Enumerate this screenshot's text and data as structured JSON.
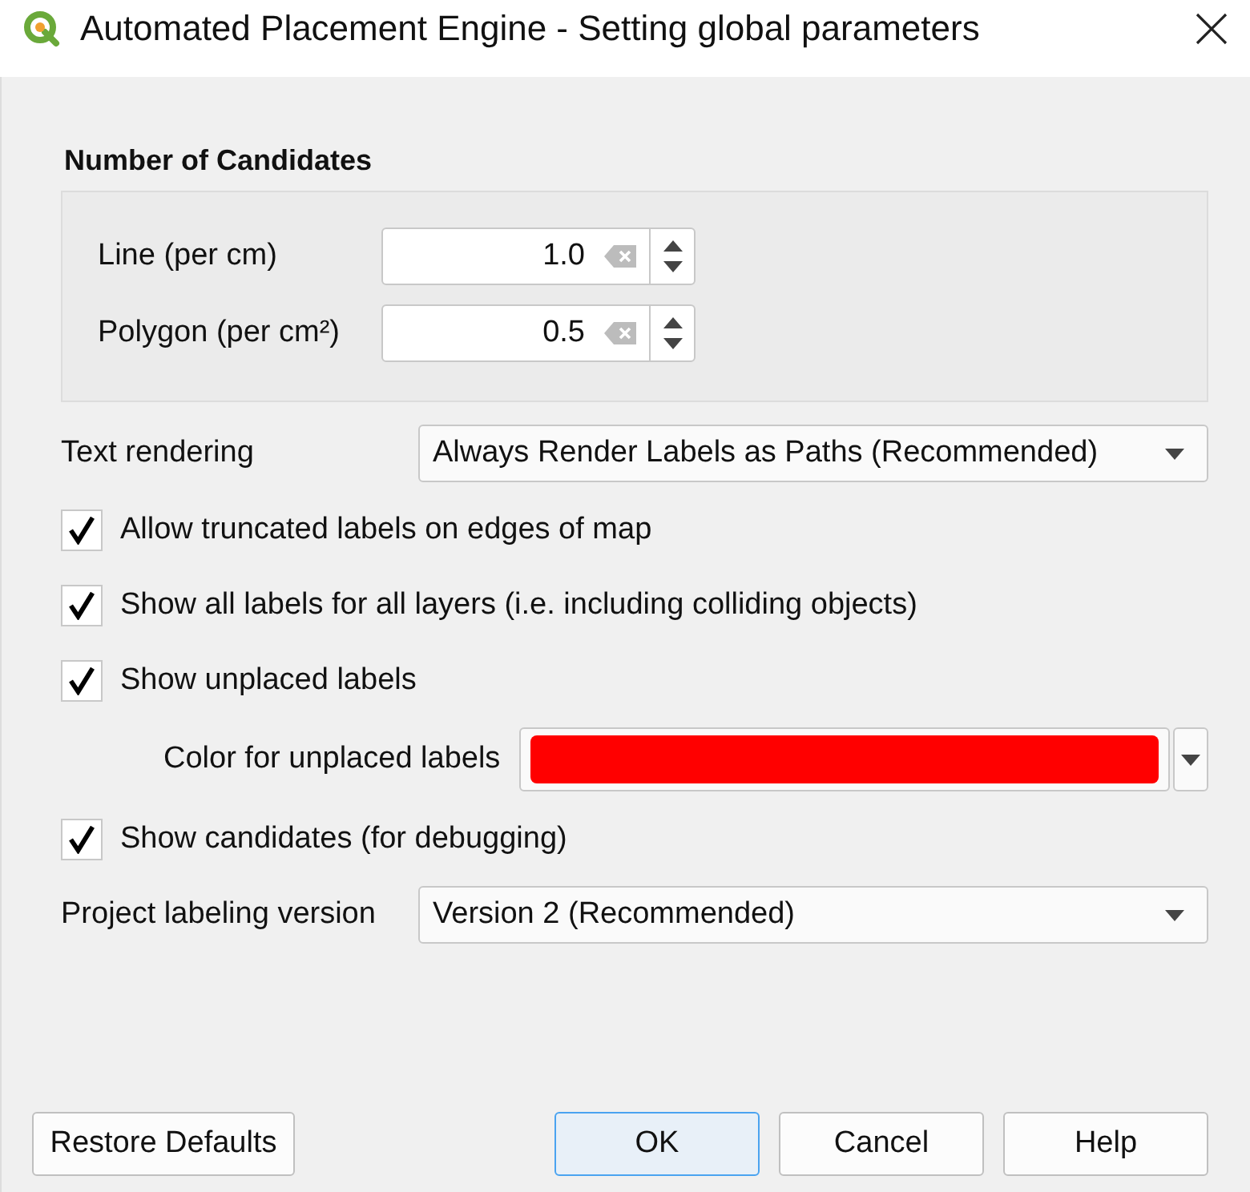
{
  "window": {
    "title": "Automated Placement Engine - Setting global parameters"
  },
  "number_of_candidates": {
    "title": "Number of Candidates",
    "fields": [
      {
        "label": "Line (per cm)",
        "value": "1.0"
      },
      {
        "label": "Polygon (per cm²)",
        "value": "0.5"
      }
    ]
  },
  "text_rendering": {
    "label": "Text rendering",
    "value": "Always Render Labels as Paths (Recommended)"
  },
  "options": [
    {
      "kind": "checkbox",
      "label": "Allow truncated labels on edges of map",
      "checked": true
    },
    {
      "kind": "checkbox",
      "label": "Show all labels for all layers (i.e. including colliding objects)",
      "checked": true
    },
    {
      "kind": "checkbox",
      "label": "Show unplaced labels",
      "checked": true
    },
    {
      "kind": "color",
      "label": "Color for unplaced labels",
      "color": "#ff0000"
    },
    {
      "kind": "checkbox",
      "label": "Show candidates (for debugging)",
      "checked": true
    }
  ],
  "labeling_version": {
    "label": "Project labeling version",
    "value": "Version 2 (Recommended)"
  },
  "buttons": [
    {
      "label": "Restore Defaults",
      "default": false
    },
    {
      "label": "OK",
      "default": true
    },
    {
      "label": "Cancel",
      "default": false
    },
    {
      "label": "Help",
      "default": false
    }
  ]
}
